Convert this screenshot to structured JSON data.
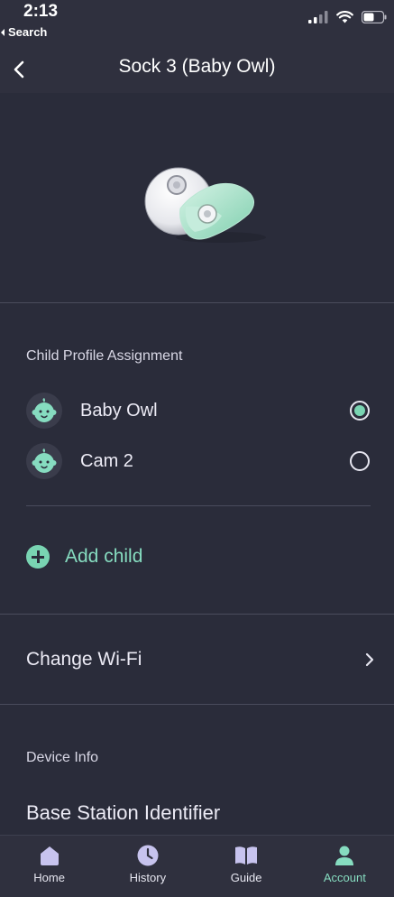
{
  "status": {
    "time": "2:13",
    "back_label": "Search"
  },
  "nav": {
    "title": "Sock 3 (Baby Owl)"
  },
  "child_profile": {
    "section_label": "Child Profile Assignment",
    "children": [
      {
        "name": "Baby Owl",
        "selected": true
      },
      {
        "name": "Cam 2",
        "selected": false
      }
    ],
    "add_label": "Add child"
  },
  "wifi": {
    "label": "Change Wi-Fi"
  },
  "device_info": {
    "section_label": "Device Info",
    "base_station_label": "Base Station Identifier"
  },
  "tabs": [
    {
      "label": "Home",
      "icon": "home-icon",
      "active": false
    },
    {
      "label": "History",
      "icon": "history-icon",
      "active": false
    },
    {
      "label": "Guide",
      "icon": "book-icon",
      "active": false
    },
    {
      "label": "Account",
      "icon": "account-icon",
      "active": true
    }
  ],
  "colors": {
    "accent": "#79d4b2",
    "background": "#2a2c3a",
    "tab_inactive": "#c7c3ee"
  }
}
